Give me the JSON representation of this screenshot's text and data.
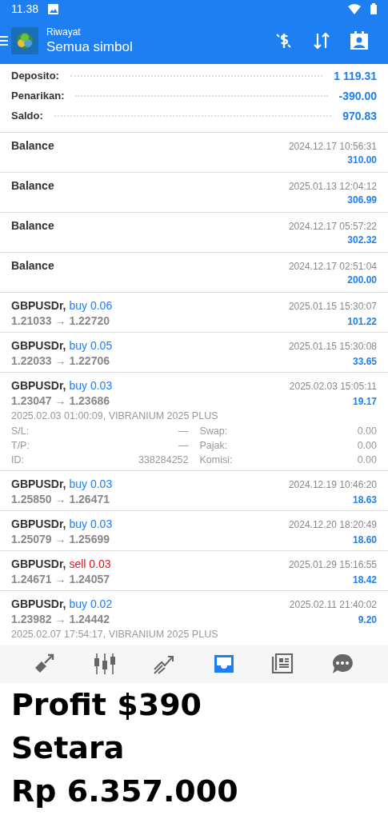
{
  "status_bar": {
    "time": "11.38"
  },
  "app_bar": {
    "title": "Riwayat",
    "subtitle": "Semua simbol"
  },
  "summary": [
    {
      "label": "Deposito:",
      "value": "1 119.31"
    },
    {
      "label": "Penarikan:",
      "value": "-390.00"
    },
    {
      "label": "Saldo:",
      "value": "970.83"
    }
  ],
  "deals": [
    {
      "kind": "balance",
      "title": "Balance",
      "time": "2024.12.17 10:56:31",
      "amount": "310.00"
    },
    {
      "kind": "balance",
      "title": "Balance",
      "time": "2025.01.13 12:04:12",
      "amount": "306.99"
    },
    {
      "kind": "balance",
      "title": "Balance",
      "time": "2024.12.17 05:57:22",
      "amount": "302.32"
    },
    {
      "kind": "balance",
      "title": "Balance",
      "time": "2024.12.17 02:51:04",
      "amount": "200.00"
    },
    {
      "kind": "trade",
      "symbol": "GBPUSDr,",
      "side": "buy",
      "volume": "0.06",
      "prices": "1.21033 → 1.22720",
      "time": "2025.01.15 15:30:07",
      "amount": "101.22"
    },
    {
      "kind": "trade",
      "symbol": "GBPUSDr,",
      "side": "buy",
      "volume": "0.05",
      "prices": "1.22033 → 1.22706",
      "time": "2025.01.15 15:30:08",
      "amount": "33.65"
    },
    {
      "kind": "trade",
      "symbol": "GBPUSDr,",
      "side": "buy",
      "volume": "0.03",
      "prices": "1.23047 → 1.23686",
      "time": "2025.02.03 15:05:11",
      "amount": "19.17",
      "expanded": true,
      "comment": "2025.02.03 01:00:09, VIBRANIUM 2025 PLUS",
      "details": [
        {
          "label": "S/L:",
          "value": "—"
        },
        {
          "label": "Swap:",
          "value": "0.00"
        },
        {
          "label": "T/P:",
          "value": "—"
        },
        {
          "label": "Pajak:",
          "value": "0.00"
        },
        {
          "label": "ID:",
          "value": "338284252"
        },
        {
          "label": "Komisi:",
          "value": "0.00"
        }
      ]
    },
    {
      "kind": "trade",
      "symbol": "GBPUSDr,",
      "side": "buy",
      "volume": "0.03",
      "prices": "1.25850 → 1.26471",
      "time": "2024.12.19 10:46:20",
      "amount": "18.63"
    },
    {
      "kind": "trade",
      "symbol": "GBPUSDr,",
      "side": "buy",
      "volume": "0.03",
      "prices": "1.25079 → 1.25699",
      "time": "2024.12.20 18:20:49",
      "amount": "18.60"
    },
    {
      "kind": "trade",
      "symbol": "GBPUSDr,",
      "side": "sell",
      "volume": "0.03",
      "prices": "1.24671 → 1.24057",
      "time": "2025.01.29 15:16:55",
      "amount": "18.42"
    },
    {
      "kind": "trade",
      "symbol": "GBPUSDr,",
      "side": "buy",
      "volume": "0.02",
      "prices": "1.23982 → 1.24442",
      "time": "2025.02.11 21:40:02",
      "amount": "9.20",
      "comment": "2025.02.07 17:54:17, VIBRANIUM 2025 PLUS"
    }
  ],
  "bottom_nav": [
    {
      "selected": false
    },
    {
      "selected": false
    },
    {
      "selected": false
    },
    {
      "selected": true
    },
    {
      "selected": false
    },
    {
      "selected": false
    }
  ],
  "caption": [
    "Profit $390",
    "Setara",
    "Rp 6.357.000"
  ]
}
